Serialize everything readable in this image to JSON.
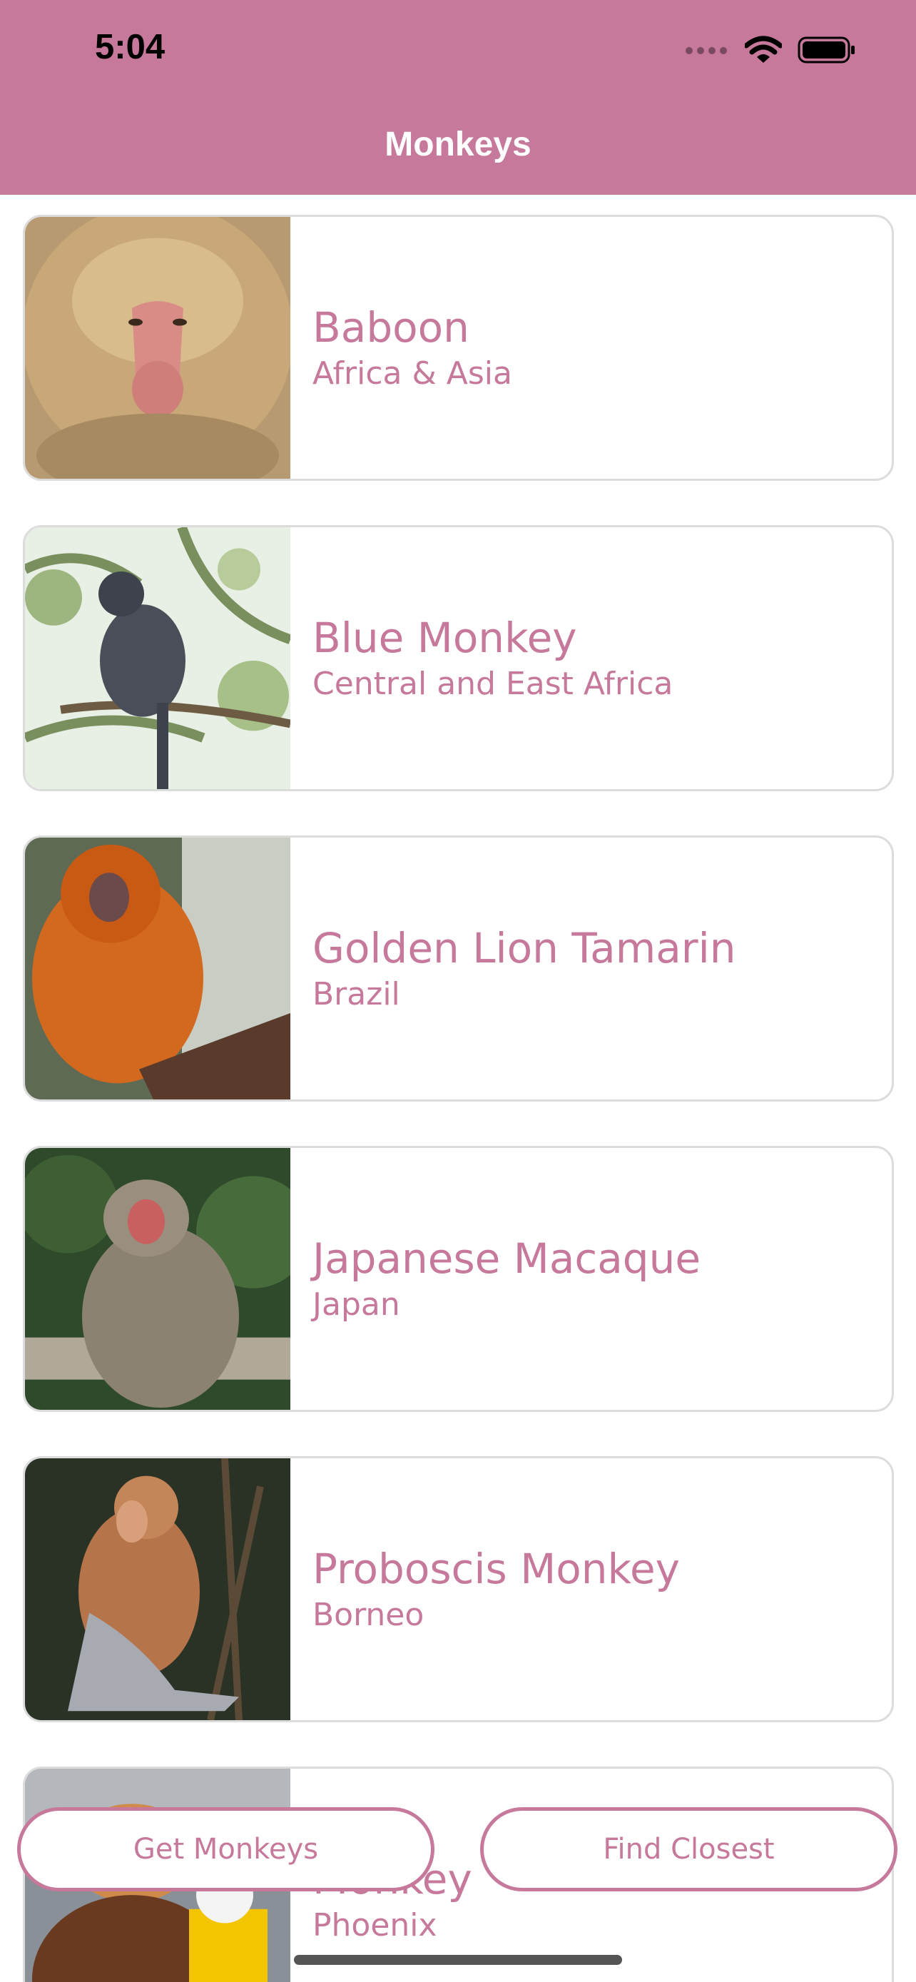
{
  "status_bar": {
    "time": "5:04"
  },
  "nav": {
    "title": "Monkeys"
  },
  "colors": {
    "accent": "#c6799b",
    "card_border": "#dcdcdc"
  },
  "monkeys": [
    {
      "name": "Baboon",
      "location": "Africa & Asia"
    },
    {
      "name": "Blue Monkey",
      "location": "Central and East Africa"
    },
    {
      "name": "Golden Lion Tamarin",
      "location": "Brazil"
    },
    {
      "name": "Japanese Macaque",
      "location": "Japan"
    },
    {
      "name": "Proboscis Monkey",
      "location": "Borneo"
    },
    {
      "name": "Monkey",
      "location": "Phoenix"
    }
  ],
  "buttons": {
    "get_monkeys": "Get Monkeys",
    "find_closest": "Find Closest"
  }
}
